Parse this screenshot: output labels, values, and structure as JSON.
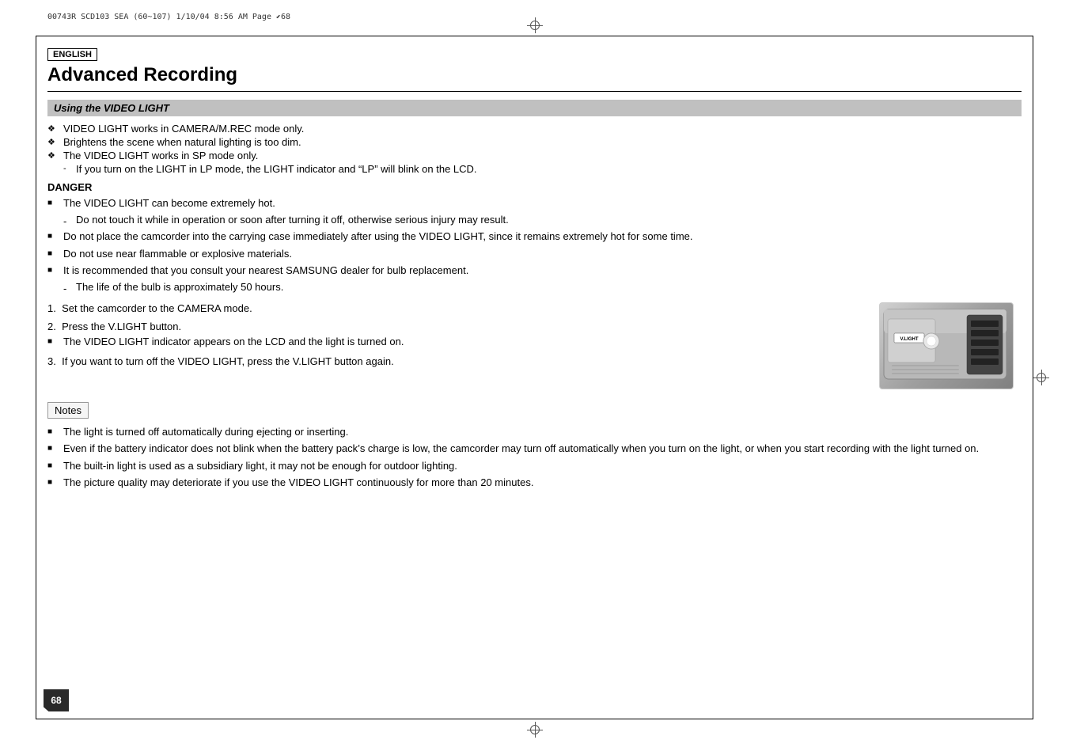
{
  "meta": {
    "top_ref": "00743R SCD103 SEA (60~107)   1/10/04 8:56 AM   Page",
    "page_number_display": "68"
  },
  "badge": {
    "label": "ENGLISH"
  },
  "title": "Advanced Recording",
  "section": {
    "label": "Using the VIDEO LIGHT"
  },
  "intro_bullets": [
    {
      "text": "VIDEO LIGHT works in CAMERA/M.REC mode only.",
      "type": "normal"
    },
    {
      "text": "Brightens the scene when natural lighting is too dim.",
      "type": "normal"
    },
    {
      "text": "The VIDEO LIGHT works in SP mode only.",
      "type": "normal"
    },
    {
      "text": "If you turn on the LIGHT in LP mode, the LIGHT indicator and “LP” will blink on the LCD.",
      "type": "sub"
    }
  ],
  "danger": {
    "title": "DANGER",
    "items": [
      {
        "text": "The VIDEO LIGHT can become extremely hot.",
        "type": "normal"
      },
      {
        "text": "Do not touch it while in operation or soon after turning it off, otherwise serious injury may result.",
        "type": "sub"
      },
      {
        "text": "Do not place the camcorder into the carrying case immediately after using the VIDEO LIGHT, since it remains extremely hot for some time.",
        "type": "normal"
      },
      {
        "text": "Do not use near flammable or explosive materials.",
        "type": "normal"
      },
      {
        "text": "It is recommended that you consult your nearest SAMSUNG dealer for bulb replacement.",
        "type": "normal"
      },
      {
        "text": "The life of the bulb is approximately 50 hours.",
        "type": "sub"
      }
    ]
  },
  "steps": [
    {
      "num": "1.",
      "text": "Set the camcorder to the CAMERA mode."
    },
    {
      "num": "2.",
      "text": "Press the V.LIGHT button."
    },
    {
      "num": "3.",
      "text": "If you want to turn off the VIDEO LIGHT, press the V.LIGHT button again."
    }
  ],
  "step2_sub": "The VIDEO LIGHT indicator appears on the LCD and the light is turned on.",
  "camera_label": "V.LIGHT",
  "notes_label": "Notes",
  "notes_items": [
    {
      "text": "The light is turned off automatically during ejecting or inserting."
    },
    {
      "text": "Even if the battery indicator does not blink when the battery pack’s charge is low, the camcorder may turn off automatically when you turn on the light, or when you start recording with the light turned on."
    },
    {
      "text": "The built-in light is used as a subsidiary light, it may not be enough for outdoor lighting."
    },
    {
      "text": "The picture quality may deteriorate if you use the VIDEO LIGHT continuously for more than 20 minutes."
    }
  ],
  "page_number": "68"
}
